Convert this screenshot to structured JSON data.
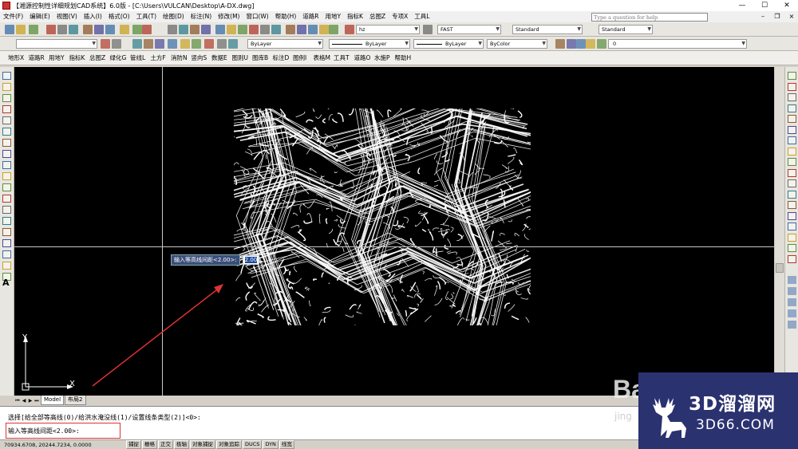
{
  "window": {
    "title": "【湘源控制性详细规划CAD系统】6.0版 - [C:\\Users\\VULCAN\\Desktop\\A-DX.dwg]",
    "minimize": "—",
    "maximize": "☐",
    "close": "✕"
  },
  "menubar": {
    "items": [
      "文件(F)",
      "编辑(E)",
      "视图(V)",
      "插入(I)",
      "格式(O)",
      "工具(T)",
      "绘图(D)",
      "标注(N)",
      "修改(M)",
      "窗口(W)",
      "帮助(H)",
      "道路R",
      "用地Y",
      "指标K",
      "总图Z",
      "专项X",
      "工具L"
    ],
    "help_placeholder": "Type a question for help"
  },
  "toolbar1": {
    "layer_combo": "hz",
    "font_combo": "FAST",
    "style_combo": "Standard",
    "dimstyle_combo": "Standard"
  },
  "toolbar2": {
    "color_combo": "ByLayer",
    "linetype_combo": "ByLayer",
    "lineweight_combo": "ByLayer",
    "plotstyle_combo": "ByColor",
    "layer_state": "0"
  },
  "custom_menu": {
    "items": [
      "地形X",
      "道路R",
      "用地Y",
      "指标K",
      "总图Z",
      "绿化G",
      "管线L",
      "土方F",
      "消防N",
      "竖向S",
      "数据E",
      "图则U",
      "图库B",
      "标注D",
      "图例I",
      "表格M",
      "工具T",
      "道路O",
      "水施P",
      "帮助H"
    ]
  },
  "canvas": {
    "prompt_label": "输入等高线间距<2.00>:",
    "prompt_value": "2.00",
    "ucs_y": "Y",
    "ucs_x": "X"
  },
  "tabs": [
    "Model",
    "布局2"
  ],
  "command": {
    "line1": "选择[给全部等高线(0)/给洪水淹没线(1)/设置线条类型(2)]<0>:",
    "line2": "输入等高线间距<2.00>:"
  },
  "status": {
    "coords": "70934.6708, 20244.7234, 0.0000",
    "buttons": [
      "捕捉",
      "栅格",
      "正交",
      "极轴",
      "对象捕捉",
      "对象追踪",
      "DUCS",
      "DYN",
      "线宽"
    ]
  },
  "watermark": {
    "main": "3D溜溜网",
    "sub": "3D66.COM",
    "bai": "Bai",
    "jing": "jing"
  },
  "colors": {
    "canvas": "#000000",
    "accent": "#2b3270",
    "highlight": "#dd3333"
  }
}
